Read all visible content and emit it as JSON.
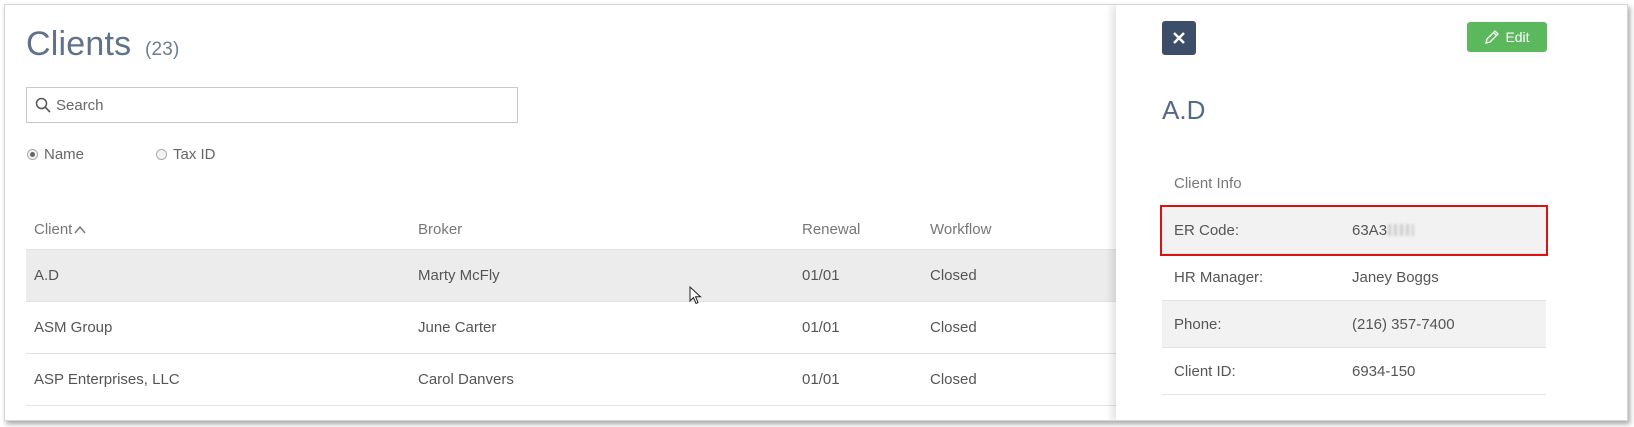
{
  "page": {
    "title": "Clients",
    "count": "(23)"
  },
  "search": {
    "placeholder": "Search",
    "value": ""
  },
  "filter": {
    "options": [
      {
        "label": "Name",
        "selected": true
      },
      {
        "label": "Tax ID",
        "selected": false
      }
    ]
  },
  "table": {
    "columns": [
      "Client",
      "Broker",
      "Renewal",
      "Workflow"
    ],
    "rows": [
      {
        "client": "A.D",
        "broker": "Marty McFly",
        "renewal": "01/01",
        "workflow": "Closed",
        "selected": true
      },
      {
        "client": "ASM Group",
        "broker": "June Carter",
        "renewal": "01/01",
        "workflow": "Closed",
        "selected": false
      },
      {
        "client": "ASP Enterprises, LLC",
        "broker": "Carol Danvers",
        "renewal": "01/01",
        "workflow": "Closed",
        "selected": false
      }
    ]
  },
  "panel": {
    "close_icon": "close-icon",
    "edit_label": "Edit",
    "edit_icon": "pencil-icon",
    "client_name": "A.D",
    "section_title": "Client Info",
    "rows": [
      {
        "label": "ER Code:",
        "value": "63A3"
      },
      {
        "label": "HR Manager:",
        "value": "Janey Boggs"
      },
      {
        "label": "Phone:",
        "value": "(216) 357-7400"
      },
      {
        "label": "Client ID:",
        "value": "6934-150"
      }
    ]
  },
  "colors": {
    "title": "#5f7289",
    "close_button": "#3d4e69",
    "edit_button": "#5cb85c",
    "highlight": "#dd1111"
  }
}
